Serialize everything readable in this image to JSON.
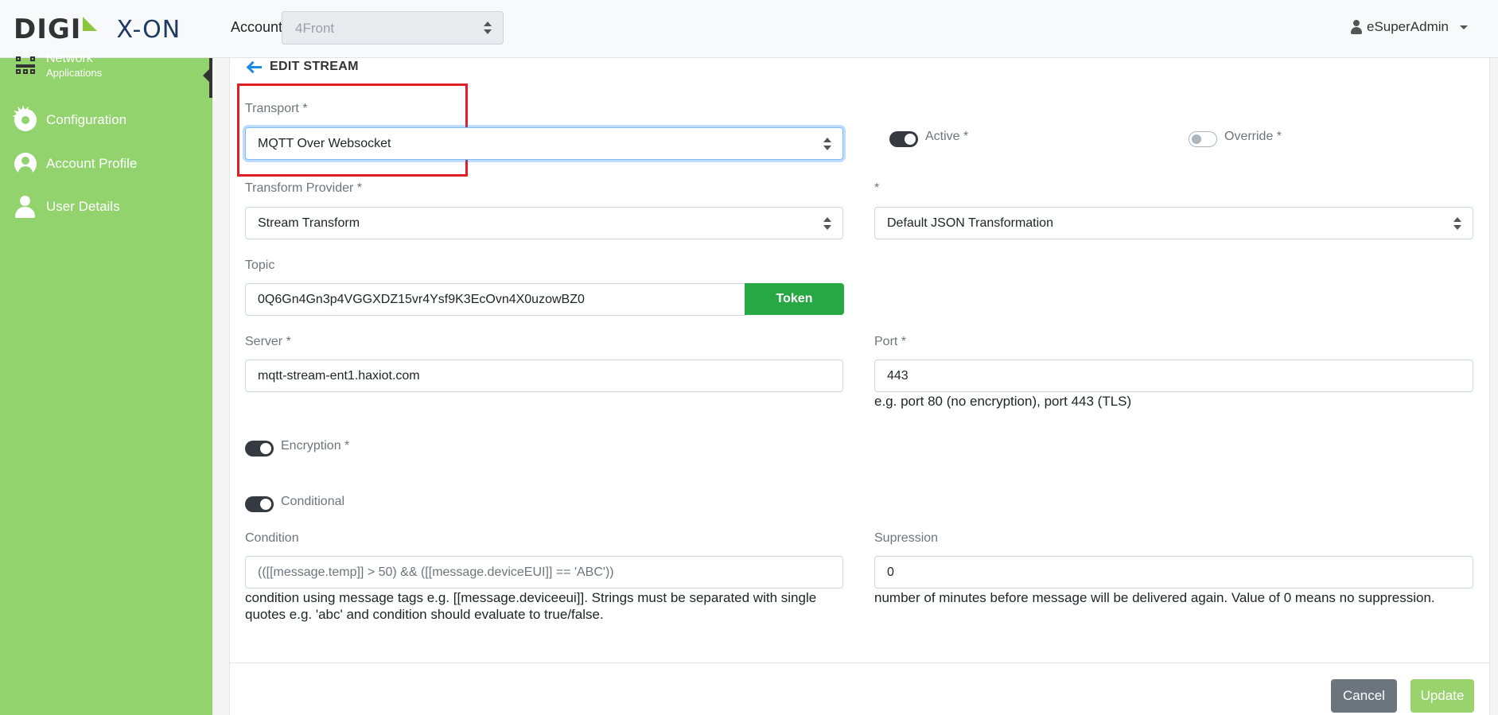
{
  "header": {
    "logo_left": "DIGI",
    "logo_right": "X-ON",
    "account_label": "Account",
    "account_value": "4Front",
    "user_name": "eSuperAdmin"
  },
  "sidebar": {
    "items": [
      {
        "label": "Network",
        "sublabel": "Applications"
      },
      {
        "label": "Configuration"
      },
      {
        "label": "Account Profile"
      },
      {
        "label": "User Details"
      }
    ]
  },
  "form": {
    "title": "EDIT STREAM",
    "transport_label": "Transport *",
    "transport_value": "MQTT Over Websocket",
    "active_label": "Active *",
    "active_on": true,
    "override_label": "Override *",
    "override_on": false,
    "transform_provider_label": "Transform Provider *",
    "transform_provider_value": "Stream Transform",
    "transform_label": "*",
    "transform_value": "Default JSON Transformation",
    "topic_label": "Topic",
    "topic_value": "0Q6Gn4Gn3p4VGGXDZ15vr4Ysf9K3EcOvn4X0uzowBZ0",
    "token_button": "Token",
    "server_label": "Server *",
    "server_value": "mqtt-stream-ent1.haxiot.com",
    "port_label": "Port *",
    "port_value": "443",
    "port_hint": "e.g. port 80 (no encryption), port 443 (TLS)",
    "encryption_label": "Encryption *",
    "encryption_on": true,
    "conditional_label": "Conditional",
    "conditional_on": true,
    "condition_label": "Condition",
    "condition_placeholder": "(([[message.temp]] > 50) && ([[message.deviceEUI]] == 'ABC'))",
    "condition_hint_line1": "condition using message tags e.g. [[message.deviceeui]]. Strings must be separated with single",
    "condition_hint_line2": "quotes e.g. 'abc' and condition should evaluate to true/false.",
    "supression_label": "Supression",
    "supression_value": "0",
    "supression_hint": "number of minutes before message will be delivered again. Value of 0 means no suppression."
  },
  "actions": {
    "cancel": "Cancel",
    "update": "Update"
  },
  "colors": {
    "sidebar": "#92d36e",
    "token_button": "#28a745",
    "cancel_button": "#6c757d",
    "update_button": "#9ad36e",
    "highlight": "#e01e24"
  }
}
